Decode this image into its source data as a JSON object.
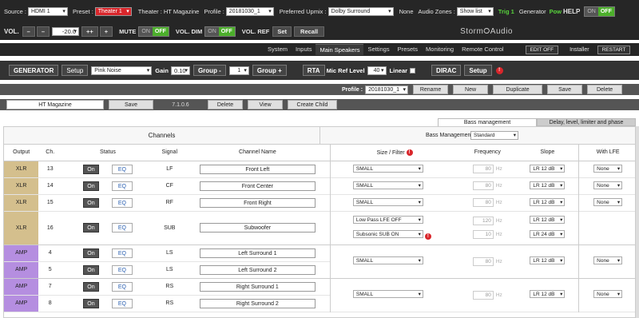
{
  "top": {
    "source_label": "Source :",
    "source_value": "HDMI 1",
    "preset_label": "Preset :",
    "preset_value": "Theater 1",
    "theater_label": "Theater : HT Magazine",
    "profile_label": "Profile :",
    "profile_value": "20181030_1",
    "upmix_label": "Preferred Upmix :",
    "upmix_value": "Dolby Surround",
    "none_text": "None",
    "audio_zones_label": "Audio Zones :",
    "audio_zones_value": "Show list",
    "trig_text": "Trig 1",
    "generator_text": "Generator",
    "pow_text": "Pow",
    "help_text": "HELP",
    "on": "ON",
    "off": "OFF"
  },
  "vol": {
    "label": "VOL.",
    "minus": "–",
    "minus2": "–",
    "value": "-20.0",
    "plusplus": "++",
    "plus": "+",
    "mute_label": "MUTE",
    "dim_label": "VOL. DIM",
    "ref_label": "VOL. REF",
    "set": "Set",
    "recall": "Recall",
    "logo": "Storm⭘Audio"
  },
  "nav": {
    "tabs": [
      "System",
      "Inputs",
      "Main Speakers",
      "Settings",
      "Presets",
      "Monitoring",
      "Remote Control"
    ],
    "active": 2,
    "edit_off": "EDIT OFF",
    "installer": "Installer",
    "restart": "RESTART"
  },
  "gen": {
    "generator": "GENERATOR",
    "setup": "Setup",
    "noise": "Pink Noise",
    "gain_label": "Gain",
    "gain_value": "0.10",
    "group_minus": "Group -",
    "group_value": "1",
    "group_plus": "Group +",
    "rta": "RTA",
    "mic_ref": "Mic Ref Level",
    "mic_value": "40",
    "linear": "Linear",
    "dirac": "DIRAC",
    "dirac_setup": "Setup"
  },
  "profile": {
    "label": "Profile :",
    "value": "20181030_1",
    "rename": "Rename",
    "new": "New",
    "duplicate": "Duplicate",
    "save": "Save",
    "delete": "Delete"
  },
  "theater": {
    "name": "HT Magazine",
    "save": "Save",
    "version": "7.1.0.6",
    "delete": "Delete",
    "view": "View",
    "create_child": "Create Child"
  },
  "subtabs": {
    "bass_management": "Bass management",
    "delay": "Delay, level, limiter and phase"
  },
  "table": {
    "channels_header": "Channels",
    "bass_mgmt_label": "Bass Management",
    "bass_mgmt_value": "Standard",
    "cols": [
      "Output",
      "Ch.",
      "Status",
      "Signal",
      "Channel Name",
      "Size / Filter",
      "Frequency",
      "Slope",
      "With LFE"
    ],
    "on": "On",
    "eq": "EQ",
    "hz": "Hz",
    "rows": [
      {
        "output": "XLR",
        "ch": "13",
        "signal": "LF",
        "name": "Front Left",
        "size": "SMALL",
        "freq": "80",
        "slope": "LR 12 dB",
        "lfe": "None"
      },
      {
        "output": "XLR",
        "ch": "14",
        "signal": "CF",
        "name": "Front Center",
        "size": "SMALL",
        "freq": "80",
        "slope": "LR 12 dB",
        "lfe": "None"
      },
      {
        "output": "XLR",
        "ch": "15",
        "signal": "RF",
        "name": "Front Right",
        "size": "SMALL",
        "freq": "80",
        "slope": "LR 12 dB",
        "lfe": "None"
      },
      {
        "output": "XLR",
        "ch": "16",
        "signal": "SUB",
        "name": "Subwoofer",
        "size": "Low Pass LFE OFF",
        "size2": "Subsonic SUB ON",
        "freq": "120",
        "freq2": "10",
        "slope": "LR 12 dB",
        "slope2": "LR 24 dB",
        "lfe": ""
      },
      {
        "output": "AMP",
        "ch": "4",
        "signal": "LS",
        "name": "Left Surround 1"
      },
      {
        "output": "AMP",
        "ch": "5",
        "signal": "LS",
        "name": "Left Surround 2",
        "size": "SMALL",
        "freq": "80",
        "slope": "LR 12 dB",
        "lfe": "None"
      },
      {
        "output": "AMP",
        "ch": "7",
        "signal": "RS",
        "name": "Right Surround 1"
      },
      {
        "output": "AMP",
        "ch": "8",
        "signal": "RS",
        "name": "Right Surround 2",
        "size": "SMALL",
        "freq": "80",
        "slope": "LR 12 dB",
        "lfe": "None"
      }
    ]
  }
}
